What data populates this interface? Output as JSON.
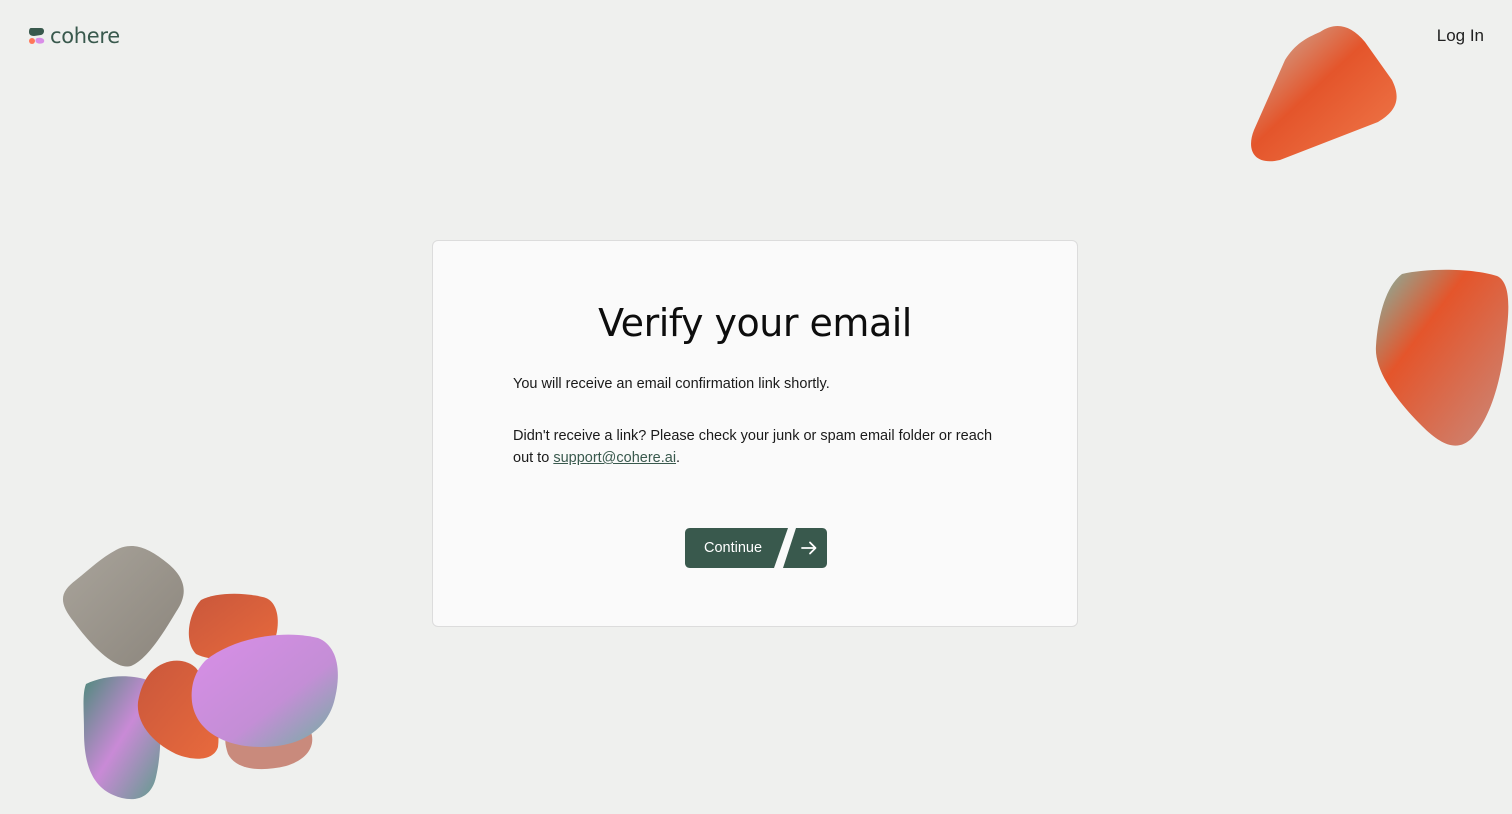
{
  "header": {
    "logo_text": "cohere",
    "login_label": "Log In"
  },
  "card": {
    "title": "Verify your email",
    "message": "You will receive an email confirmation link shortly.",
    "help_prefix": "Didn't receive a link? Please check your junk or spam email folder or reach out to ",
    "support_email": "support@cohere.ai",
    "help_suffix": ".",
    "continue_label": "Continue",
    "arrow_icon": "arrow-right-icon"
  },
  "colors": {
    "background": "#eff0ee",
    "card": "#fafafa",
    "brand_green": "#39594d",
    "accent_orange": "#e4552b",
    "accent_pink": "#d98ee8"
  }
}
